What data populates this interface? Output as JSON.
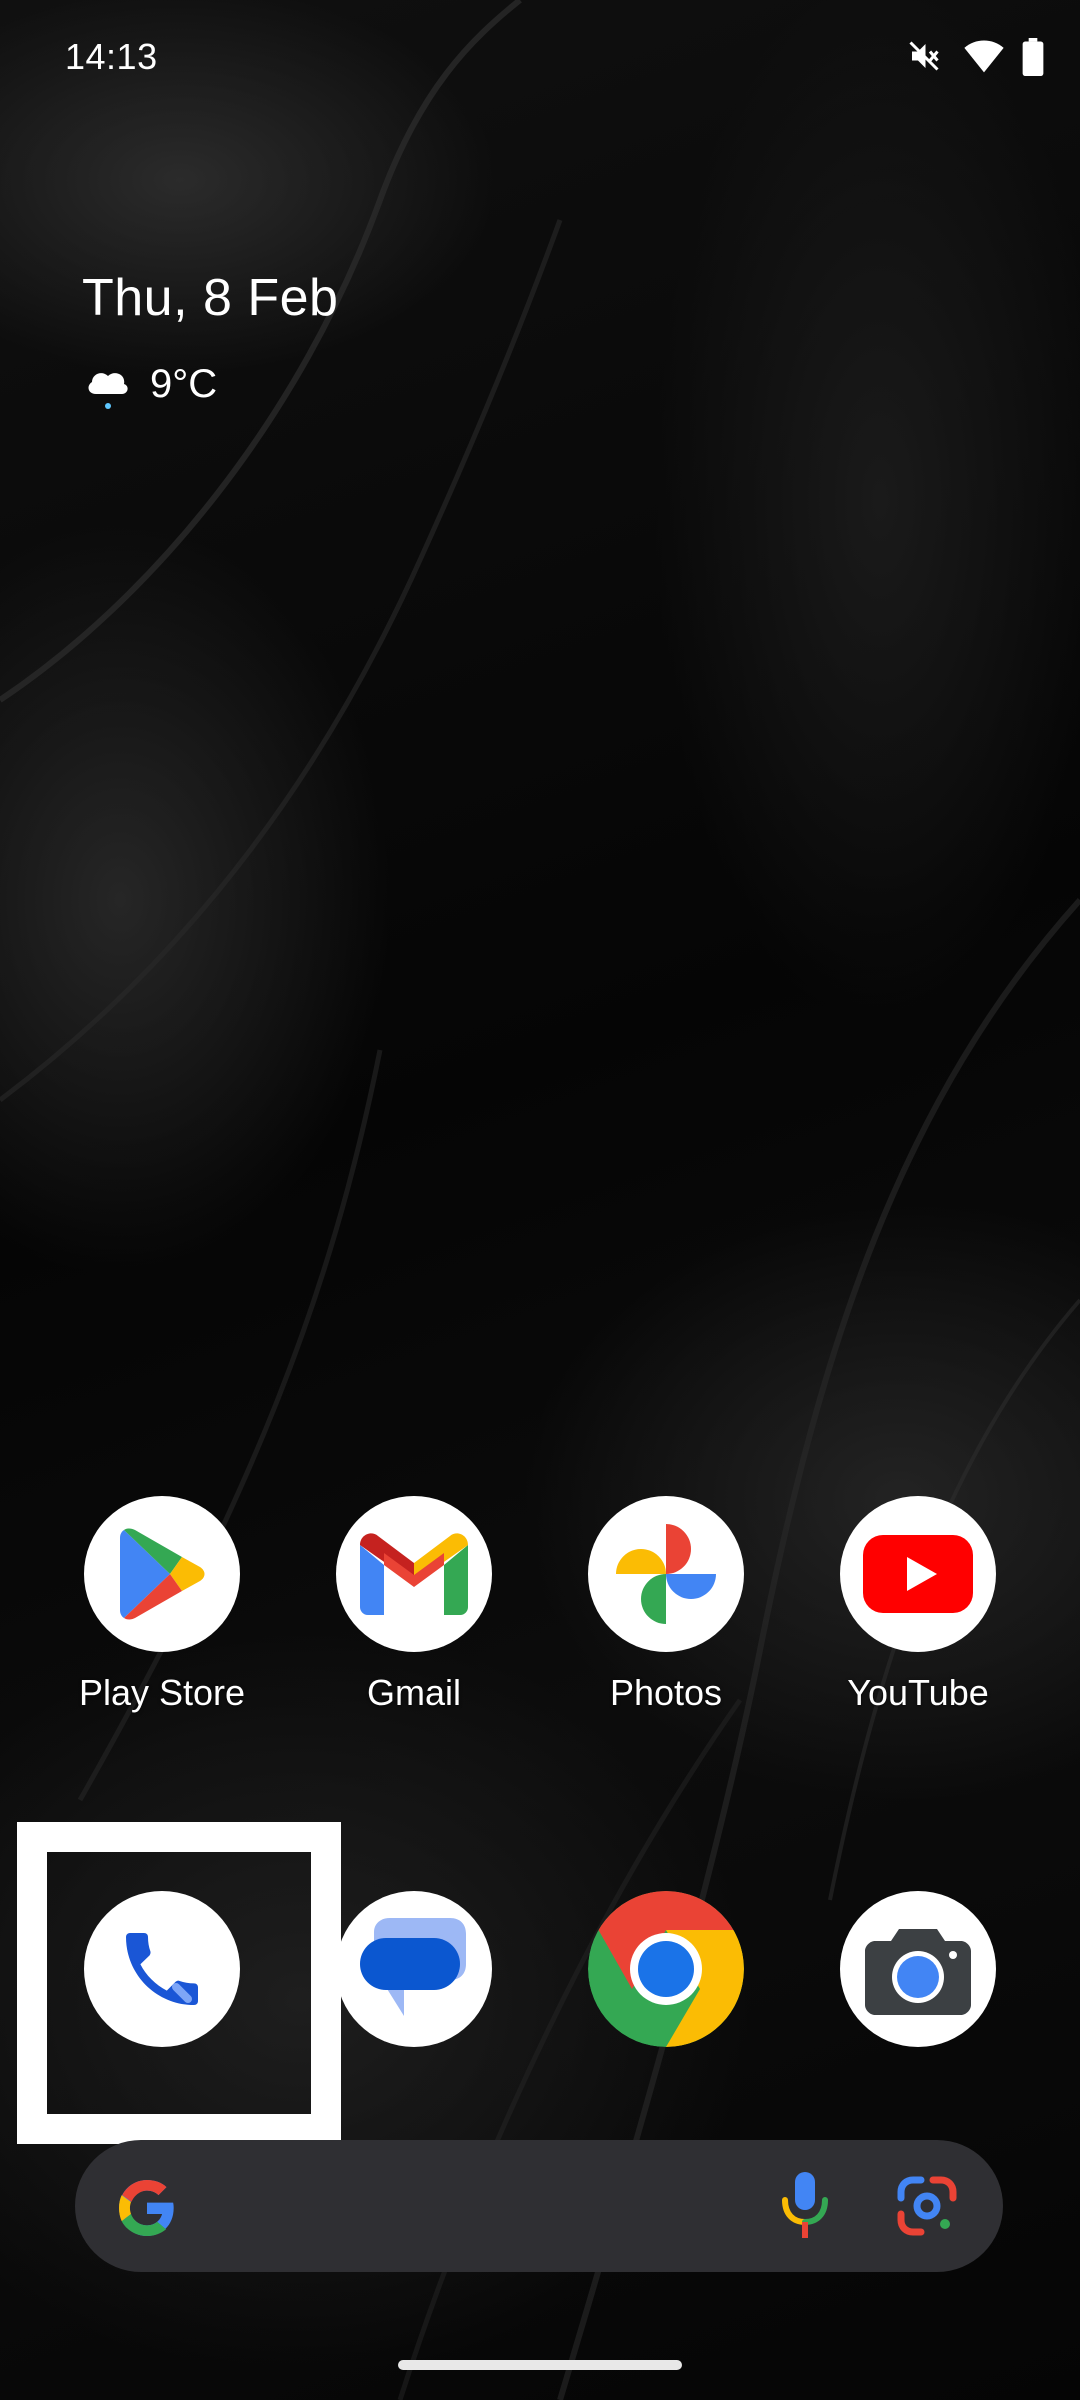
{
  "status_bar": {
    "time": "14:13",
    "icons": [
      "mute-icon",
      "wifi-icon",
      "battery-icon"
    ]
  },
  "date_widget": {
    "date": "Thu, 8 Feb",
    "weather_icon": "cloudy-night-icon",
    "temperature": "9°C"
  },
  "apps_row1": [
    {
      "label": "Play Store",
      "icon": "play-store-icon"
    },
    {
      "label": "Gmail",
      "icon": "gmail-icon"
    },
    {
      "label": "Photos",
      "icon": "photos-icon"
    },
    {
      "label": "YouTube",
      "icon": "youtube-icon"
    }
  ],
  "dock": [
    {
      "icon": "phone-icon",
      "highlighted": true
    },
    {
      "icon": "messages-icon"
    },
    {
      "icon": "chrome-icon"
    },
    {
      "icon": "camera-icon"
    }
  ],
  "search_bar": {
    "icons": [
      "google-logo-icon",
      "microphone-icon",
      "google-lens-icon"
    ]
  },
  "colors": {
    "google_blue": "#4285F4",
    "google_red": "#EA4335",
    "google_yellow": "#FBBC04",
    "google_green": "#34A853",
    "search_bar_bg": "#2f2f33",
    "phone_blue": "#1a56d6"
  }
}
